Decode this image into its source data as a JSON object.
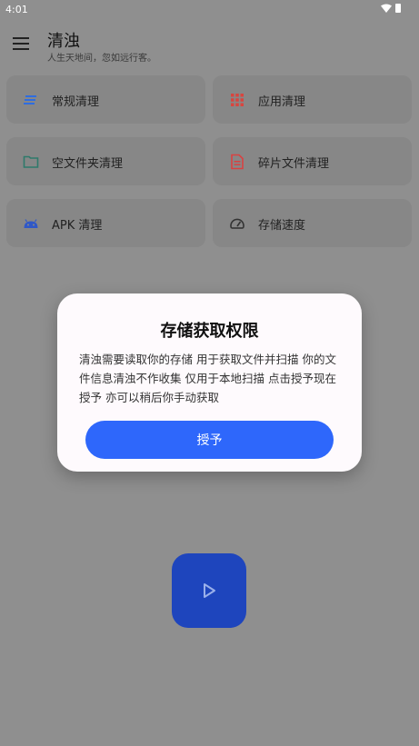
{
  "status_bar": {
    "time": "4:01"
  },
  "app_bar": {
    "title": "清浊",
    "subtitle": "人生天地间，忽如远行客。"
  },
  "cards": [
    {
      "label": "常规清理",
      "icon": "list-lines-icon",
      "color": "#2f6de0"
    },
    {
      "label": "应用清理",
      "icon": "apps-grid-icon",
      "color": "#d8453f"
    },
    {
      "label": "空文件夹清理",
      "icon": "folder-icon",
      "color": "#2f7a6b"
    },
    {
      "label": "碎片文件清理",
      "icon": "document-icon",
      "color": "#d84242"
    },
    {
      "label": "APK 清理",
      "icon": "android-icon",
      "color": "#2f58c8"
    },
    {
      "label": "存储速度",
      "icon": "speedometer-icon",
      "color": "#333333"
    }
  ],
  "dialog": {
    "title": "存储获取权限",
    "body": "清浊需要读取你的存储 用于获取文件并扫描 你的文件信息清浊不作收集 仅用于本地扫描 点击授予现在授予 亦可以稍后你手动获取",
    "button_label": "授予"
  },
  "fab": {
    "icon": "play-icon"
  }
}
